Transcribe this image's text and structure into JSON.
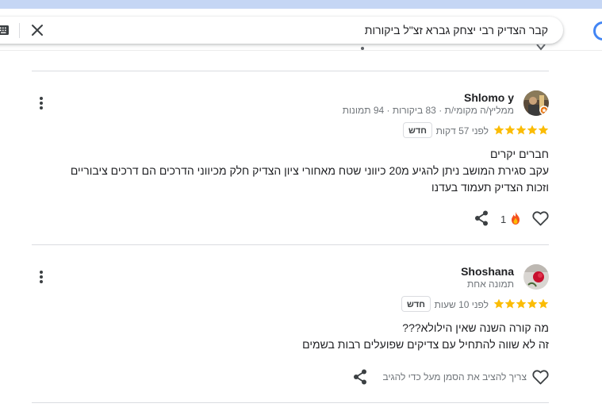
{
  "search": {
    "query": "קבר הצדיק רבי יצחק גברא זצ\"ל ביקורות"
  },
  "reviews": [
    {
      "name": "Shlomo y",
      "meta": "ממליץ/ה מקומי/ת · 83 ביקורות · 94 תמונות",
      "rating": 5,
      "time": "לפני 57 דקות",
      "badge": "חדש",
      "lines": [
        "חברים יקרים",
        "עקב סגירת המושב ניתן להגיע מ20 כיווני שטח מאחורי ציון הצדיק חלק מכיווני הדרכים הם דרכים ציבוריים",
        "וזכות הצדיק תעמוד בעדנו"
      ],
      "reaction_count": "1"
    },
    {
      "name": "Shoshana",
      "meta": "תמונה אחת",
      "rating": 5,
      "time": "לפני 10 שעות",
      "badge": "חדש",
      "lines": [
        "מה קורה השנה שאין הילולא???",
        "זה לא שווה להתחיל עם צדיקים שפועלים רבות בשמים"
      ],
      "like_hint": "צריך להציב את הסמן מעל כדי להגיב"
    }
  ],
  "colors": {
    "star": "#fbbc04",
    "divider": "#dadce0",
    "accent": "#4285f4"
  }
}
